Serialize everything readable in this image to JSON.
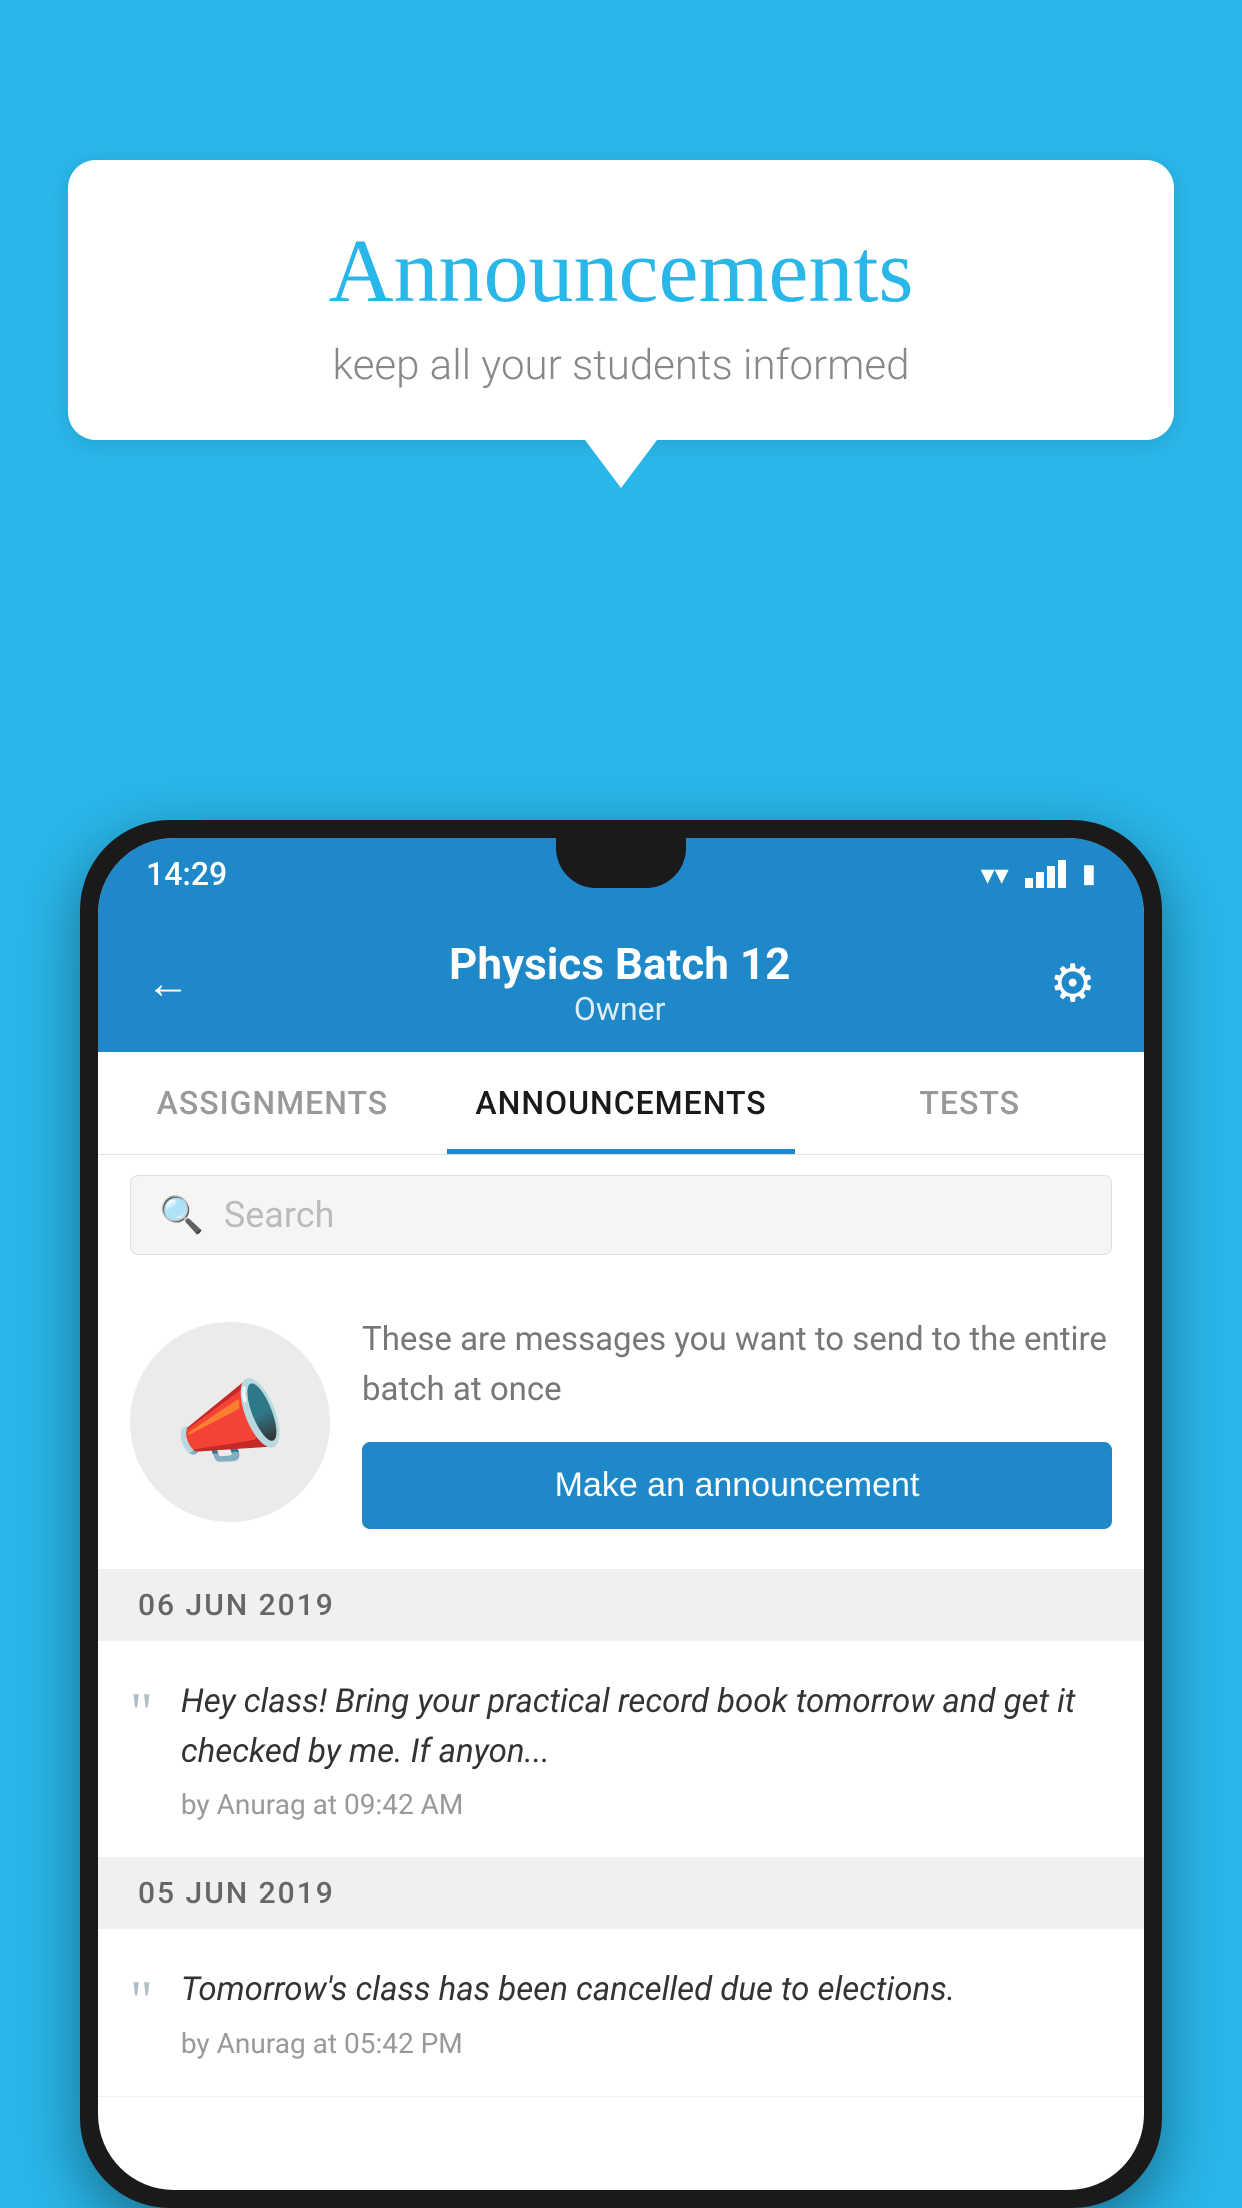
{
  "background_color": "#29b6e8",
  "speech_bubble": {
    "title": "Announcements",
    "subtitle": "keep all your students informed"
  },
  "phone": {
    "status_bar": {
      "time": "14:29"
    },
    "header": {
      "title": "Physics Batch 12",
      "subtitle": "Owner",
      "back_label": "←",
      "gear_label": "⚙"
    },
    "tabs": [
      {
        "label": "ASSIGNMENTS",
        "active": false
      },
      {
        "label": "ANNOUNCEMENTS",
        "active": true
      },
      {
        "label": "TESTS",
        "active": false
      }
    ],
    "search": {
      "placeholder": "Search"
    },
    "promo": {
      "text": "These are messages you want to send to the entire batch at once",
      "button_label": "Make an announcement"
    },
    "announcements": [
      {
        "date": "06  JUN  2019",
        "text": "Hey class! Bring your practical record book tomorrow and get it checked by me. If anyon...",
        "meta": "by Anurag at 09:42 AM"
      },
      {
        "date": "05  JUN  2019",
        "text": "Tomorrow's class has been cancelled due to elections.",
        "meta": "by Anurag at 05:42 PM"
      }
    ]
  }
}
